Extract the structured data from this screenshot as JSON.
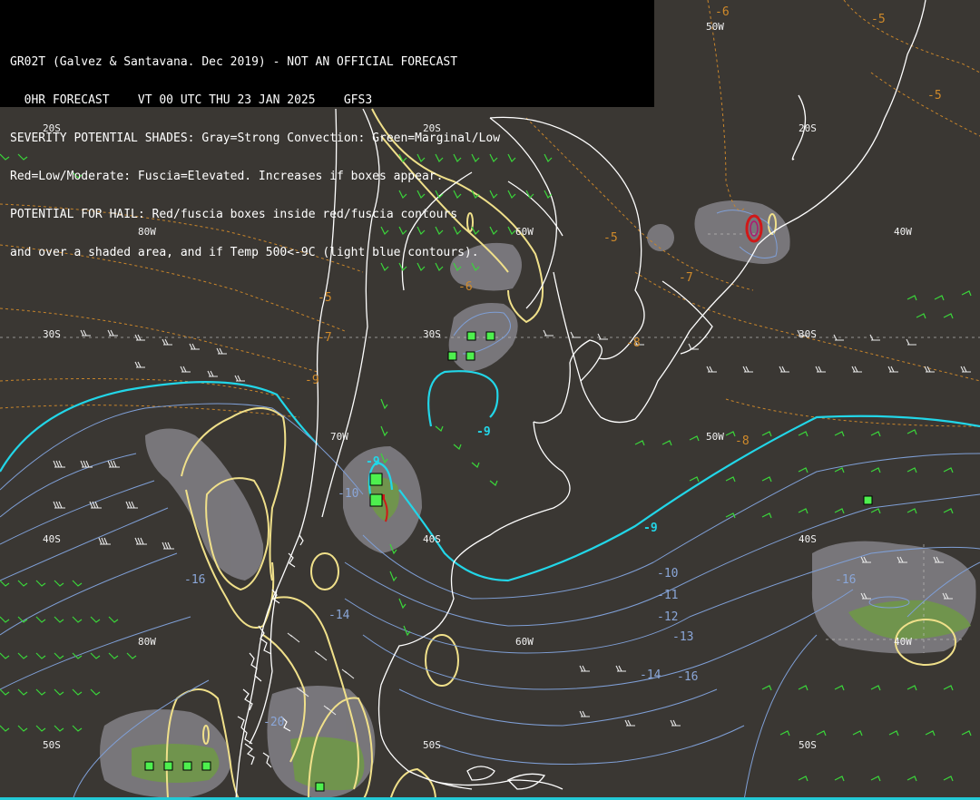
{
  "header": {
    "line1": "GR02T (Galvez & Santavana. Dec 2019) - NOT AN OFFICIAL FORECAST",
    "line2": "  0HR FORECAST    VT 00 UTC THU 23 JAN 2025    GFS3",
    "line3": "SEVERITY POTENTIAL SHADES: Gray=Strong Convection: Green=Marginal/Low",
    "line4": "Red=Low/Moderate: Fuscia=Elevated. Increases if boxes appear.",
    "line5": "POTENTIAL FOR HAIL: Red/fuscia boxes inside red/fuscia contours",
    "line6": "and over a shaded area, and if Temp 500<-9C (light blue contours)."
  },
  "grid_labels": {
    "lat20_west": "20S",
    "lat20_mid": "20S",
    "lat20_east": "20S",
    "lat30_west": "30S",
    "lat30_mid": "30S",
    "lat30_east": "30S",
    "lat40_west": "40S",
    "lat40_mid": "40S",
    "lat40_east": "40S",
    "lat50_west": "50S",
    "lat50_mid": "50S",
    "lat50_east": "50S",
    "lon80_north": "80W",
    "lon80_south": "80W",
    "lon70": "70W",
    "lon60_north": "60W",
    "lon60_south": "60W",
    "lon50_north": "50W",
    "lon50_mid": "50W",
    "lon40_north": "40W",
    "lon40_south": "40W"
  },
  "temp850_labels": {
    "a": "-6",
    "b": "-5",
    "c": "-5",
    "d": "-5",
    "e": "-6",
    "f": "-7",
    "g": "-5",
    "h": "-7",
    "i": "-8",
    "j": "-9",
    "k": "-8"
  },
  "temp500_labels": {
    "a": "-9",
    "b": "-9",
    "c": "-9",
    "d": "-10",
    "e": "-10",
    "f": "-11",
    "g": "-12",
    "h": "-13",
    "i": "-14",
    "j": "-16",
    "k": "-14",
    "l": "-16",
    "m": "-16",
    "n": "-20"
  },
  "colors": {
    "background": "#3a3733",
    "coastline": "#ffffff",
    "gray_shade": "#8d8c93",
    "green_shade": "#6f9a45",
    "yellow_contour": "#f0e08a",
    "cyan_contour": "#22d6e8",
    "blue_contour": "#7f9fd6",
    "orange_dashed": "#c8852b",
    "wind_green": "#3ad63a",
    "wind_white": "#e8e8e8",
    "box_fill": "#4ef04e",
    "hail_red": "#d01818"
  }
}
